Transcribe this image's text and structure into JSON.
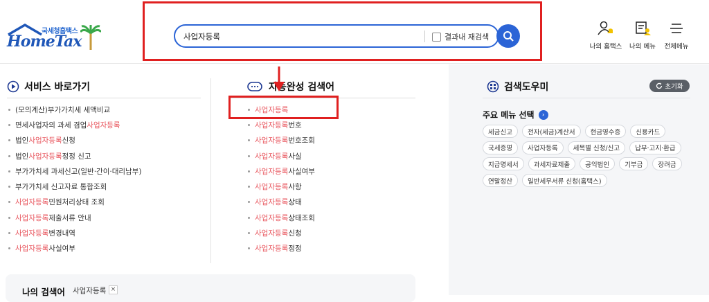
{
  "header": {
    "logo_kr": "국세청홈택스",
    "logo_en": "HomeTax",
    "search": {
      "value": "사업자등록",
      "checkbox_label": "결과내 재검색"
    },
    "menu": [
      {
        "label": "나의 홈택스",
        "icon": "user-bell-icon"
      },
      {
        "label": "나의 메뉴",
        "icon": "user-list-icon"
      },
      {
        "label": "전체메뉴",
        "icon": "hamburger-icon"
      }
    ]
  },
  "services": {
    "title": "서비스 바로가기",
    "items": [
      {
        "pre": "(모의계산)부가가치세 세액비교",
        "hl": "",
        "post": ""
      },
      {
        "pre": "면세사업자의 과세 겸업 ",
        "hl": "사업자등록",
        "post": ""
      },
      {
        "pre": "법인 ",
        "hl": "사업자등록",
        "post": " 신청"
      },
      {
        "pre": "법인 ",
        "hl": "사업자등록",
        "post": " 정정 신고"
      },
      {
        "pre": "부가가치세 과세신고(일반·간이·대리납부)",
        "hl": "",
        "post": ""
      },
      {
        "pre": "부가가치세 신고자료 통합조회",
        "hl": "",
        "post": ""
      },
      {
        "pre": "",
        "hl": "사업자등록",
        "post": " 민원처리상태 조회"
      },
      {
        "pre": "",
        "hl": "사업자등록",
        "post": " 제출서류 안내"
      },
      {
        "pre": "",
        "hl": "사업자등록",
        "post": "변경내역"
      },
      {
        "pre": "",
        "hl": "사업자등록",
        "post": "사실여부"
      }
    ]
  },
  "autocomplete": {
    "title": "자동완성 검색어",
    "items": [
      {
        "hl": "사업자등록",
        "post": ""
      },
      {
        "hl": "사업자등록",
        "post": "번호"
      },
      {
        "hl": "사업자등록",
        "post": "번호조회"
      },
      {
        "hl": "사업자등록",
        "post": "사실"
      },
      {
        "hl": "사업자등록",
        "post": "사실여부"
      },
      {
        "hl": "사업자등록",
        "post": "사항"
      },
      {
        "hl": "사업자등록",
        "post": "상태"
      },
      {
        "hl": "사업자등록",
        "post": "상태조회"
      },
      {
        "hl": "사업자등록",
        "post": "신청"
      },
      {
        "hl": "사업자등록",
        "post": "정정"
      }
    ]
  },
  "my_search": {
    "title": "나의 검색어",
    "keyword": "사업자등록",
    "remove": "×"
  },
  "helper": {
    "title": "검색도우미",
    "reset_label": "초기화",
    "main_menu_title": "주요 메뉴 선택",
    "tag_rows": [
      [
        "세금신고",
        "전자(세금)계산서",
        "현금영수증",
        "신용카드"
      ],
      [
        "국세증명",
        "사업자등록",
        "세목별 신청/신고",
        "납부·고지·환급"
      ],
      [
        "지급명세서",
        "과세자료제출",
        "공익법인",
        "기부금",
        "장려금"
      ],
      [
        "연말정산",
        "일반세무서류 신청(홈택스)"
      ]
    ]
  },
  "colors": {
    "accent": "#2b64d6",
    "highlight": "#e8555d",
    "annotation": "#e02020"
  }
}
